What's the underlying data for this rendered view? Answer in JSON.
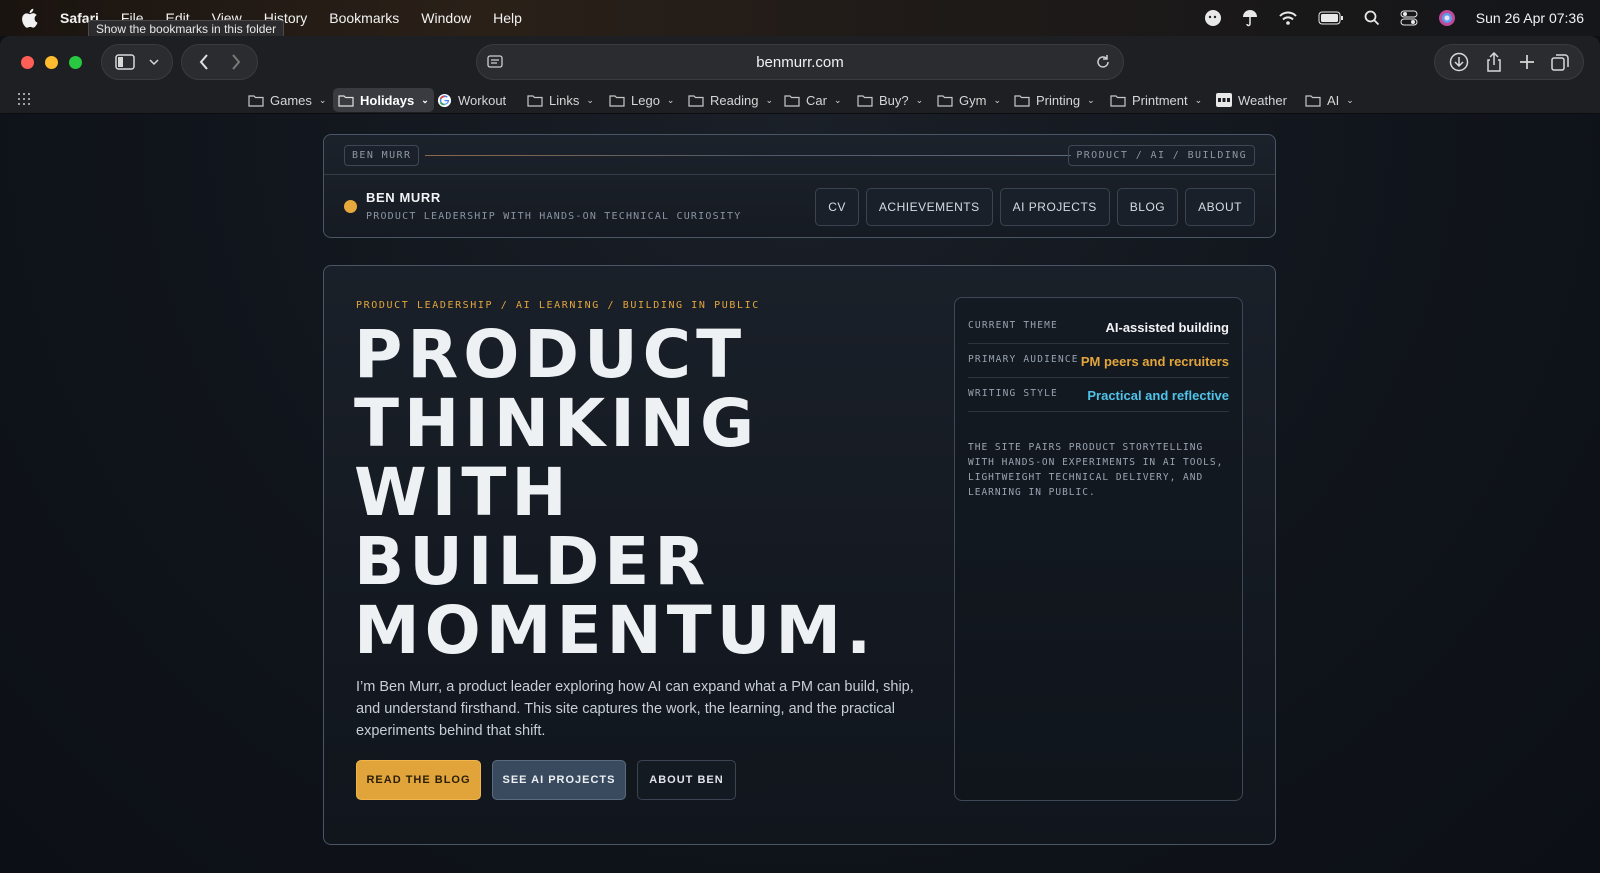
{
  "menubar": {
    "app": "Safari",
    "items": [
      "File",
      "Edit",
      "View",
      "History",
      "Bookmarks",
      "Window",
      "Help"
    ],
    "clock": "Sun 26 Apr  07:36",
    "tooltip": "Show the bookmarks in this folder"
  },
  "browser": {
    "url": "benmurr.com",
    "bookmarks": [
      {
        "label": "Games",
        "type": "folder"
      },
      {
        "label": "Holidays",
        "type": "folder",
        "active": true
      },
      {
        "label": "Workout",
        "type": "google"
      },
      {
        "label": "Links",
        "type": "folder"
      },
      {
        "label": "Lego",
        "type": "folder"
      },
      {
        "label": "Reading",
        "type": "folder"
      },
      {
        "label": "Car",
        "type": "folder"
      },
      {
        "label": "Buy?",
        "type": "folder"
      },
      {
        "label": "Gym",
        "type": "folder"
      },
      {
        "label": "Printing",
        "type": "folder"
      },
      {
        "label": "Printment",
        "type": "folder"
      },
      {
        "label": "Weather",
        "type": "site"
      },
      {
        "label": "AI",
        "type": "folder"
      }
    ]
  },
  "site": {
    "header": {
      "tag_left": "BEN MURR",
      "tag_right": "PRODUCT / AI / BUILDING",
      "brand_name": "BEN MURR",
      "brand_tagline": "PRODUCT LEADERSHIP WITH HANDS-ON TECHNICAL CURIOSITY",
      "nav": [
        "CV",
        "ACHIEVEMENTS",
        "AI PROJECTS",
        "BLOG",
        "ABOUT"
      ]
    },
    "hero": {
      "eyebrow": "PRODUCT LEADERSHIP / AI LEARNING / BUILDING IN PUBLIC",
      "headline": [
        "PRODUCT",
        "THINKING",
        "WITH",
        "BUILDER",
        "MOMENTUM."
      ],
      "intro": "I’m Ben Murr, a product leader exploring how AI can expand what a PM can build, ship, and understand firsthand. This site captures the work, the learning, and the practical experiments behind that shift.",
      "cta_primary": "READ THE BLOG",
      "cta_secondary": "SEE AI PROJECTS",
      "cta_tertiary": "ABOUT BEN"
    },
    "panel": {
      "rows": [
        {
          "key": "CURRENT THEME",
          "value": "AI-assisted building",
          "color": "#f1f3f6"
        },
        {
          "key": "PRIMARY AUDIENCE",
          "value": "PM peers and recruiters",
          "color": "#e3a63b"
        },
        {
          "key": "WRITING STYLE",
          "value": "Practical and reflective",
          "color": "#4fc3e8"
        }
      ],
      "description": "THE SITE PAIRS PRODUCT STORYTELLING WITH HANDS-ON EXPERIMENTS IN AI TOOLS, LIGHTWEIGHT TECHNICAL DELIVERY, AND LEARNING IN PUBLIC."
    }
  },
  "colors": {
    "accent": "#e0a43a",
    "cyan": "#4fc3e8",
    "background": "#10141b"
  }
}
